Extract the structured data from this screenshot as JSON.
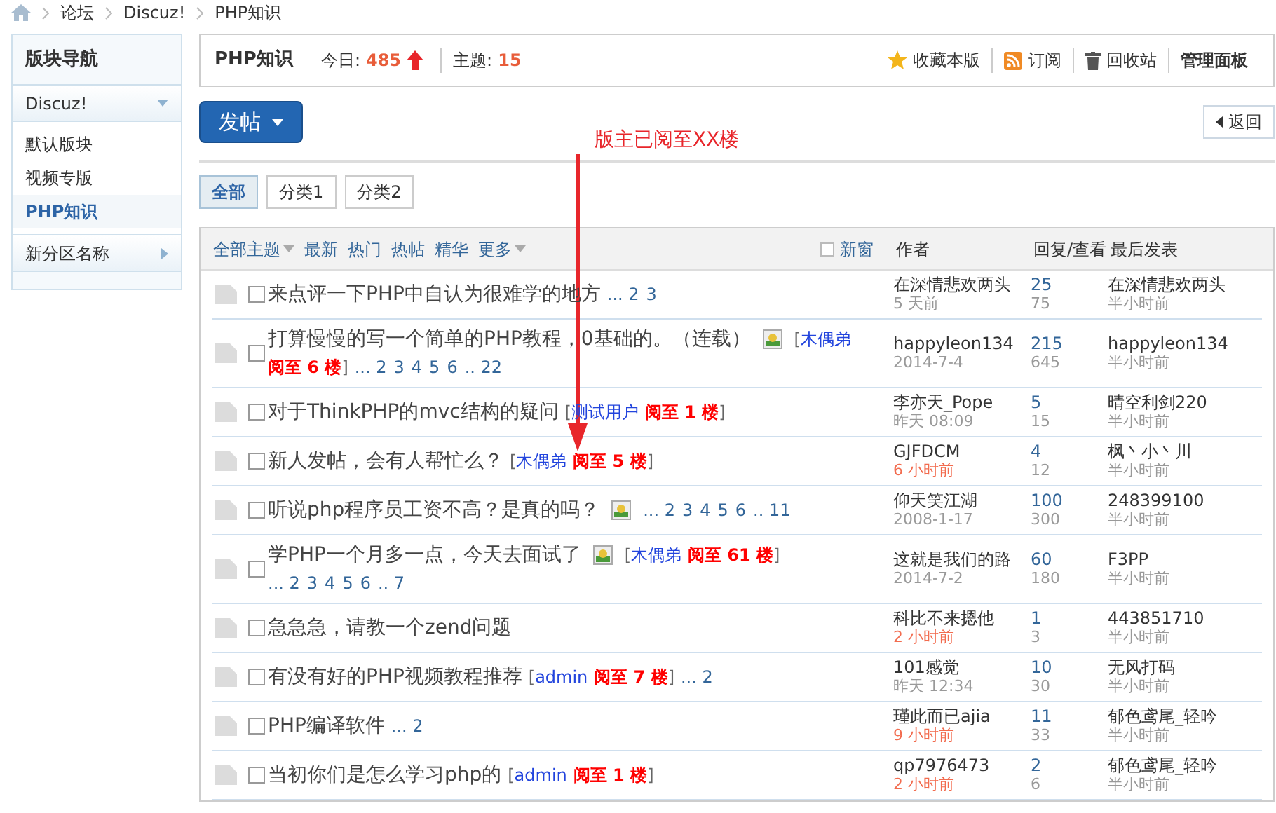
{
  "breadcrumb": [
    "论坛",
    "Discuz!",
    "PHP知识"
  ],
  "sidebar": {
    "title": "版块导航",
    "groups": [
      {
        "label": "Discuz!",
        "expanded": true,
        "items": [
          {
            "label": "默认版块",
            "selected": false
          },
          {
            "label": "视频专版",
            "selected": false
          },
          {
            "label": "PHP知识",
            "selected": true
          }
        ]
      },
      {
        "label": "新分区名称",
        "expanded": false
      }
    ]
  },
  "forum": {
    "name": "PHP知识",
    "today_label": "今日:",
    "today": "485",
    "threads_label": "主题:",
    "threads": "15",
    "actions": [
      {
        "kind": "star",
        "label": "收藏本版"
      },
      {
        "kind": "rss",
        "label": "订阅"
      },
      {
        "kind": "trash",
        "label": "回收站"
      },
      {
        "kind": "bold",
        "label": "管理面板"
      }
    ]
  },
  "post_button": "发帖",
  "back_button": "返回",
  "annotation": "版主已阅至XX楼",
  "type_tabs": [
    {
      "label": "全部",
      "selected": true
    },
    {
      "label": "分类1",
      "selected": false
    },
    {
      "label": "分类2",
      "selected": false
    }
  ],
  "filters": [
    {
      "label": "全部主题",
      "dropdown": true
    },
    {
      "label": "最新",
      "dropdown": false
    },
    {
      "label": "热门",
      "dropdown": false
    },
    {
      "label": "热帖",
      "dropdown": false
    },
    {
      "label": "精华",
      "dropdown": false
    },
    {
      "label": "更多",
      "dropdown": true
    }
  ],
  "new_window": {
    "label": "新窗",
    "checked": false
  },
  "columns": [
    "作者",
    "回复/查看",
    "最后发表"
  ],
  "threads": [
    {
      "checked": false,
      "title": "来点评一下PHP中自认为很难学的地方",
      "image": false,
      "pages": [
        "... 2",
        "3"
      ],
      "author": "在深情悲欢两头",
      "time": "5 天前",
      "recent": false,
      "replies": "25",
      "views": "75",
      "last_user": "在深情悲欢两头",
      "last_time": "半小时前"
    },
    {
      "checked": false,
      "title": "打算慢慢的写一个简单的PHP教程，0基础的。（连载）",
      "image": true,
      "note": {
        "before": "[",
        "user": "木偶弟",
        "reading": "阅至 6 楼",
        "after": "]"
      },
      "pages": [
        "... 2",
        "3",
        "4",
        "5",
        "6",
        ".. 22"
      ],
      "author": "happyleon134",
      "time": "2014-7-4",
      "recent": false,
      "replies": "215",
      "views": "645",
      "last_user": "happyleon134",
      "last_time": "半小时前"
    },
    {
      "checked": false,
      "title": "对于ThinkPHP的mvc结构的疑问",
      "image": false,
      "note": {
        "before": "[",
        "user": "测试用户",
        "reading": "阅至 1 楼",
        "after": "]"
      },
      "author": "李亦天_Pope",
      "time": "昨天 08:09",
      "recent": false,
      "replies": "5",
      "views": "15",
      "last_user": "晴空利剑220",
      "last_time": "半小时前"
    },
    {
      "checked": false,
      "title": "新人发帖，会有人帮忙么？",
      "image": false,
      "note": {
        "before": "[",
        "user": "木偶弟",
        "reading": "阅至 5 楼",
        "after": "]"
      },
      "author": "GJFDCM",
      "time": "6 小时前",
      "recent": true,
      "replies": "4",
      "views": "12",
      "last_user": "枫丶小丶川",
      "last_time": "半小时前"
    },
    {
      "checked": false,
      "title": "听说php程序员工资不高？是真的吗？",
      "image": true,
      "pages": [
        "... 2",
        "3",
        "4",
        "5",
        "6",
        ".. 11"
      ],
      "author": "仰天笑江湖",
      "time": "2008-1-17",
      "recent": false,
      "replies": "100",
      "views": "300",
      "last_user": "248399100",
      "last_time": "半小时前"
    },
    {
      "checked": false,
      "title": "学PHP一个月多一点，今天去面试了",
      "image": true,
      "note": {
        "before": "[",
        "user": "木偶弟",
        "reading": "阅至 61 楼",
        "after": "]"
      },
      "pages": [
        "... 2",
        "3",
        "4",
        "5",
        "6",
        ".. 7"
      ],
      "author": "这就是我们的路",
      "time": "2014-7-2",
      "recent": false,
      "replies": "60",
      "views": "180",
      "last_user": "F3PP",
      "last_time": "半小时前"
    },
    {
      "checked": false,
      "title": "急急急，请教一个zend问题",
      "image": false,
      "author": "科比不来摁他",
      "time": "2 小时前",
      "recent": true,
      "replies": "1",
      "views": "3",
      "last_user": "443851710",
      "last_time": "半小时前"
    },
    {
      "checked": false,
      "title": "有没有好的PHP视频教程推荐",
      "image": false,
      "note": {
        "before": "[",
        "user": "admin",
        "reading": "阅至 7 楼",
        "after": "]"
      },
      "pages": [
        "... 2"
      ],
      "author": "101感觉",
      "time": "昨天 12:34",
      "recent": false,
      "replies": "10",
      "views": "30",
      "last_user": "无风打码",
      "last_time": "半小时前"
    },
    {
      "checked": false,
      "title": "PHP编译软件",
      "image": false,
      "pages": [
        "... 2"
      ],
      "author": "瑾此而已ajia",
      "time": "9 小时前",
      "recent": true,
      "replies": "11",
      "views": "33",
      "last_user": "郁色鸢尾_轻吟",
      "last_time": "半小时前"
    },
    {
      "checked": false,
      "title": "当初你们是怎么学习php的",
      "image": false,
      "note": {
        "before": "[",
        "user": "admin",
        "reading": "阅至 1 楼",
        "after": "]"
      },
      "author": "qp7976473",
      "time": "2 小时前",
      "recent": true,
      "replies": "2",
      "views": "6",
      "last_user": "郁色鸢尾_轻吟",
      "last_time": "半小时前"
    }
  ]
}
